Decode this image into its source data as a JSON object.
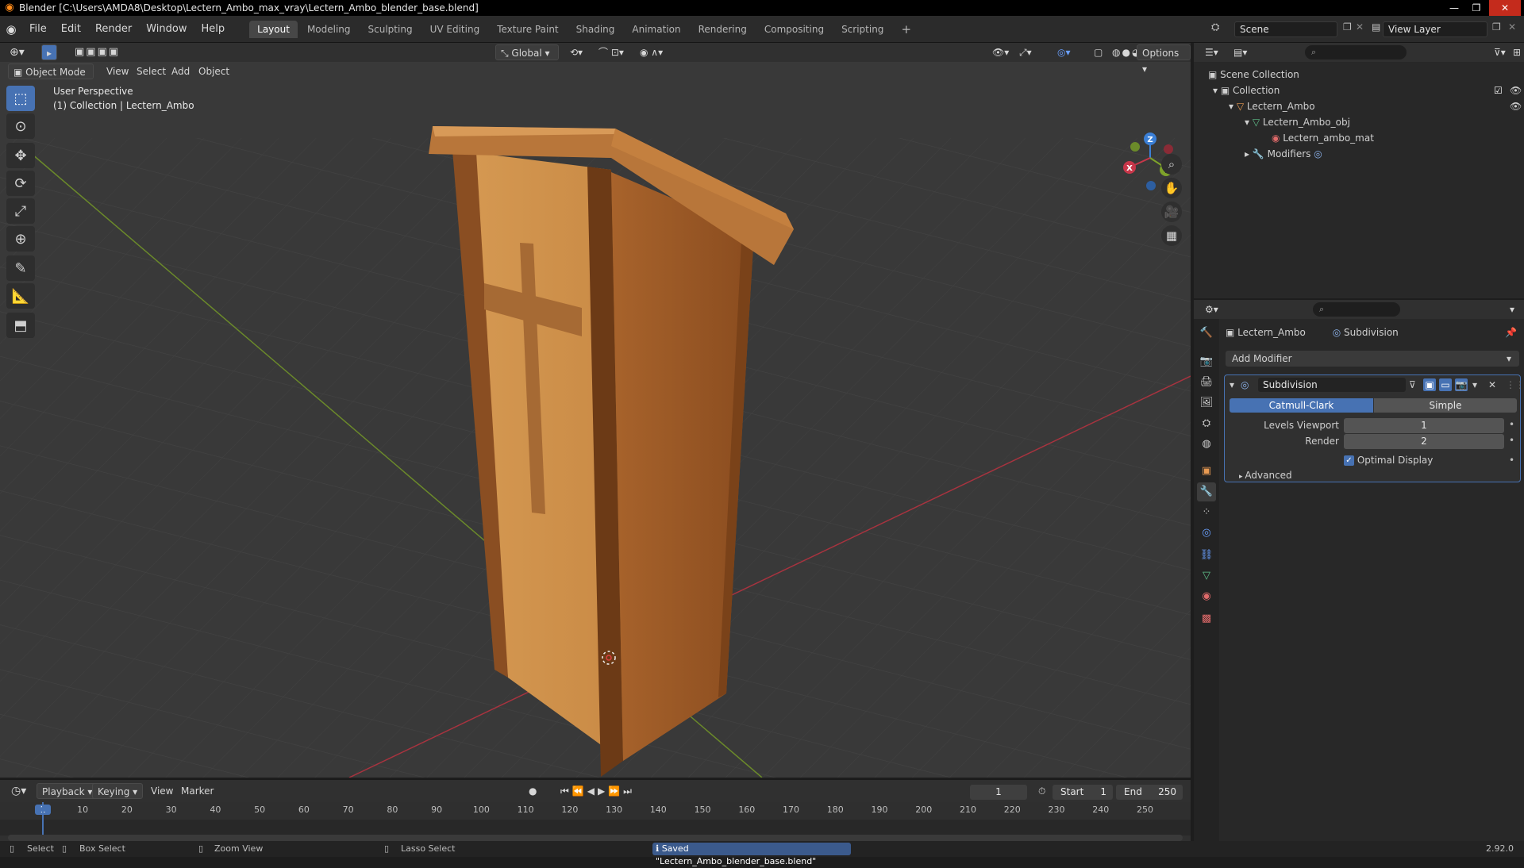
{
  "window": {
    "title": "Blender [C:\\Users\\AMDA8\\Desktop\\Lectern_Ambo_max_vray\\Lectern_Ambo_blender_base.blend]",
    "minimize": "—",
    "maximize": "❐",
    "close": "✕"
  },
  "menu": {
    "items": [
      "File",
      "Edit",
      "Render",
      "Window",
      "Help"
    ]
  },
  "workspaces": {
    "tabs": [
      "Layout",
      "Modeling",
      "Sculpting",
      "UV Editing",
      "Texture Paint",
      "Shading",
      "Animation",
      "Rendering",
      "Compositing",
      "Scripting"
    ],
    "active": "Layout",
    "add": "+"
  },
  "scene": {
    "name": "Scene",
    "view_layer": "View Layer"
  },
  "viewport_header": {
    "mode": "Object Mode",
    "menus": [
      "View",
      "Select",
      "Add",
      "Object"
    ],
    "transform_orientation": "Global",
    "options": "Options"
  },
  "viewport": {
    "perspective_label": "User Perspective",
    "collection_label": "(1) Collection | Lectern_Ambo",
    "gizmo": {
      "x": "X",
      "y": "Y",
      "z": "Z"
    }
  },
  "outliner": {
    "root": "Scene Collection",
    "collection": "Collection",
    "object": "Lectern_Ambo",
    "mesh": "Lectern_Ambo_obj",
    "material": "Lectern_ambo_mat",
    "modifiers": "Modifiers"
  },
  "properties": {
    "breadcrumb_object": "Lectern_Ambo",
    "breadcrumb_modifier": "Subdivision",
    "add_modifier": "Add Modifier",
    "modifier_name": "Subdivision",
    "catmull": "Catmull-Clark",
    "simple": "Simple",
    "levels_viewport_label": "Levels Viewport",
    "levels_viewport_value": "1",
    "render_label": "Render",
    "render_value": "2",
    "optimal_display": "Optimal Display",
    "advanced": "Advanced"
  },
  "timeline": {
    "menus": [
      "Playback",
      "Keying",
      "View",
      "Marker"
    ],
    "current_frame": "1",
    "start_label": "Start",
    "start_value": "1",
    "end_label": "End",
    "end_value": "250",
    "ticks": [
      "1",
      "10",
      "20",
      "30",
      "40",
      "50",
      "60",
      "70",
      "80",
      "90",
      "100",
      "110",
      "120",
      "130",
      "140",
      "150",
      "160",
      "170",
      "180",
      "190",
      "200",
      "210",
      "220",
      "230",
      "240",
      "250"
    ]
  },
  "status": {
    "select": "Select",
    "box_select": "Box Select",
    "zoom_view": "Zoom View",
    "lasso_select": "Lasso Select",
    "message": "Saved \"Lectern_Ambo_blender_base.blend\"",
    "version": "2.92.0"
  },
  "colors": {
    "accent": "#4772b3",
    "x_axis": "#c8374a",
    "y_axis": "#7ea32a",
    "z_axis": "#3b7fd6",
    "wood": "#c0823f"
  }
}
